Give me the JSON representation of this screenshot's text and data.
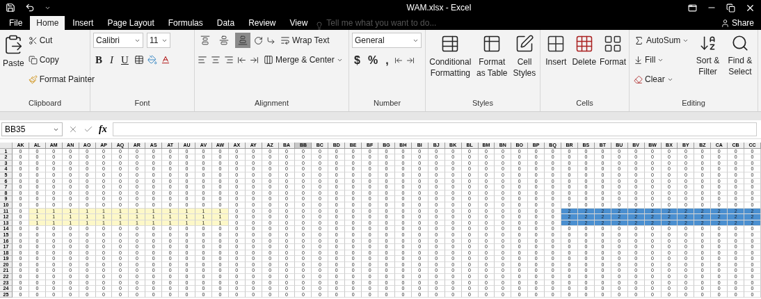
{
  "window": {
    "title": "WAM.xlsx - Excel"
  },
  "tabs": [
    {
      "label": "File",
      "selected": false
    },
    {
      "label": "Home",
      "selected": true
    },
    {
      "label": "Insert",
      "selected": false
    },
    {
      "label": "Page Layout",
      "selected": false
    },
    {
      "label": "Formulas",
      "selected": false
    },
    {
      "label": "Data",
      "selected": false
    },
    {
      "label": "Review",
      "selected": false
    },
    {
      "label": "View",
      "selected": false
    }
  ],
  "tell_me": {
    "placeholder": "Tell me what you want to do..."
  },
  "share": "Share",
  "clipboard": {
    "label": "Clipboard",
    "paste": "Paste",
    "cut": "Cut",
    "copy": "Copy",
    "format_painter": "Format Painter"
  },
  "font": {
    "label": "Font",
    "name": "Calibri",
    "size": "11",
    "bold": "B",
    "italic": "I",
    "underline": "U"
  },
  "alignment": {
    "label": "Alignment",
    "vertical": [
      {
        "selected": false
      },
      {
        "selected": false
      },
      {
        "selected": true
      }
    ],
    "wrap_text": "Wrap Text",
    "merge_center": "Merge & Center"
  },
  "number": {
    "label": "Number",
    "format": "General",
    "currency": "$",
    "percent": "%",
    "comma": ","
  },
  "styles": {
    "label": "Styles",
    "buttons": [
      {
        "kind": "conditional",
        "label": "Conditional Formatting"
      },
      {
        "kind": "table",
        "label": "Format as Table"
      },
      {
        "kind": "cellstyles",
        "label": "Cell Styles"
      }
    ]
  },
  "cells": {
    "label": "Cells",
    "buttons": [
      {
        "kind": "insert",
        "label": "Insert"
      },
      {
        "kind": "delete",
        "label": "Delete"
      },
      {
        "kind": "format",
        "label": "Format"
      }
    ]
  },
  "editing": {
    "label": "Editing",
    "autosum": "AutoSum",
    "fill": "Fill",
    "clear": "Clear",
    "sort": "Sort & Filter",
    "find": "Find & Select"
  },
  "formula_bar": {
    "name_box": "BB35",
    "fx": "fx"
  },
  "columns": [
    {
      "label": "AK",
      "selected": false
    },
    {
      "label": "AL",
      "selected": false
    },
    {
      "label": "AM",
      "selected": false
    },
    {
      "label": "AN",
      "selected": false
    },
    {
      "label": "AO",
      "selected": false
    },
    {
      "label": "AP",
      "selected": false
    },
    {
      "label": "AQ",
      "selected": false
    },
    {
      "label": "AR",
      "selected": false
    },
    {
      "label": "AS",
      "selected": false
    },
    {
      "label": "AT",
      "selected": false
    },
    {
      "label": "AU",
      "selected": false
    },
    {
      "label": "AV",
      "selected": false
    },
    {
      "label": "AW",
      "selected": false
    },
    {
      "label": "AX",
      "selected": false
    },
    {
      "label": "AY",
      "selected": false
    },
    {
      "label": "AZ",
      "selected": false
    },
    {
      "label": "BA",
      "selected": false
    },
    {
      "label": "BB",
      "selected": true
    },
    {
      "label": "BC",
      "selected": false
    },
    {
      "label": "BD",
      "selected": false
    },
    {
      "label": "BE",
      "selected": false
    },
    {
      "label": "BF",
      "selected": false
    },
    {
      "label": "BG",
      "selected": false
    },
    {
      "label": "BH",
      "selected": false
    },
    {
      "label": "BI",
      "selected": false
    },
    {
      "label": "BJ",
      "selected": false
    },
    {
      "label": "BK",
      "selected": false
    },
    {
      "label": "BL",
      "selected": false
    },
    {
      "label": "BM",
      "selected": false
    },
    {
      "label": "BN",
      "selected": false
    },
    {
      "label": "BO",
      "selected": false
    },
    {
      "label": "BP",
      "selected": false
    },
    {
      "label": "BQ",
      "selected": false
    },
    {
      "label": "BR",
      "selected": false
    },
    {
      "label": "BS",
      "selected": false
    },
    {
      "label": "BT",
      "selected": false
    },
    {
      "label": "BU",
      "selected": false
    },
    {
      "label": "BV",
      "selected": false
    },
    {
      "label": "BW",
      "selected": false
    },
    {
      "label": "BX",
      "selected": false
    },
    {
      "label": "BY",
      "selected": false
    },
    {
      "label": "BZ",
      "selected": false
    },
    {
      "label": "CA",
      "selected": false
    },
    {
      "label": "CB",
      "selected": false
    },
    {
      "label": "CC",
      "selected": false
    }
  ],
  "rows": [
    {
      "number": "1",
      "segments": [
        {
          "values": [
            "0",
            "0",
            "0",
            "0",
            "0",
            "0",
            "0",
            "0",
            "0",
            "0",
            "0",
            "0",
            "0",
            "0",
            "0",
            "0",
            "0",
            "0",
            "0",
            "0",
            "0",
            "0",
            "0",
            "0",
            "0",
            "0",
            "0",
            "0",
            "0",
            "0",
            "0",
            "0",
            "0",
            "0",
            "0",
            "0",
            "0",
            "0",
            "0",
            "0",
            "0",
            "0",
            "0",
            "0",
            "0"
          ]
        }
      ]
    },
    {
      "number": "2",
      "segments": [
        {
          "values": [
            "0",
            "0",
            "0",
            "0",
            "0",
            "0",
            "0",
            "0",
            "0",
            "0",
            "0",
            "0",
            "0",
            "0",
            "0",
            "0",
            "0",
            "0",
            "0",
            "0",
            "0",
            "0",
            "0",
            "0",
            "0",
            "0",
            "0",
            "0",
            "0",
            "0",
            "0",
            "0",
            "0",
            "0",
            "0",
            "0",
            "0",
            "0",
            "0",
            "0",
            "0",
            "0",
            "0",
            "0",
            "0"
          ]
        }
      ]
    },
    {
      "number": "3",
      "segments": [
        {
          "values": [
            "0",
            "0",
            "0",
            "0",
            "0",
            "0",
            "0",
            "0",
            "0",
            "0",
            "0",
            "0",
            "0",
            "0",
            "0",
            "0",
            "0",
            "0",
            "0",
            "0",
            "0",
            "0",
            "0",
            "0",
            "0",
            "0",
            "0",
            "0",
            "0",
            "0",
            "0",
            "0",
            "0",
            "0",
            "0",
            "0",
            "0",
            "0",
            "0",
            "0",
            "0",
            "0",
            "0",
            "0",
            "0"
          ]
        }
      ]
    },
    {
      "number": "4",
      "segments": [
        {
          "values": [
            "0",
            "0",
            "0",
            "0",
            "0",
            "0",
            "0",
            "0",
            "0",
            "0",
            "0",
            "0",
            "0",
            "0",
            "0",
            "0",
            "0",
            "0",
            "0",
            "0",
            "0",
            "0",
            "0",
            "0",
            "0",
            "0",
            "0",
            "0",
            "0",
            "0",
            "0",
            "0",
            "0",
            "0",
            "0",
            "0",
            "0",
            "0",
            "0",
            "0",
            "0",
            "0",
            "0",
            "0",
            "0"
          ]
        }
      ]
    },
    {
      "number": "5",
      "segments": [
        {
          "values": [
            "0",
            "0",
            "0",
            "0",
            "0",
            "0",
            "0",
            "0",
            "0",
            "0",
            "0",
            "0",
            "0",
            "0",
            "0",
            "0",
            "0",
            "0",
            "0",
            "0",
            "0",
            "0",
            "0",
            "0",
            "0",
            "0",
            "0",
            "0",
            "0",
            "0",
            "0",
            "0",
            "0",
            "0",
            "0",
            "0",
            "0",
            "0",
            "0",
            "0",
            "0",
            "0",
            "0",
            "0",
            "0"
          ]
        }
      ]
    },
    {
      "number": "6",
      "segments": [
        {
          "values": [
            "0",
            "0",
            "0",
            "0",
            "0",
            "0",
            "0",
            "0",
            "0",
            "0",
            "0",
            "0",
            "0",
            "0",
            "0",
            "0",
            "0",
            "0",
            "0",
            "0",
            "0",
            "0",
            "0",
            "0",
            "0",
            "0",
            "0",
            "0",
            "0",
            "0",
            "0",
            "0",
            "0",
            "0",
            "0",
            "0",
            "0",
            "0",
            "0",
            "0",
            "0",
            "0",
            "0",
            "0",
            "0"
          ]
        }
      ]
    },
    {
      "number": "7",
      "segments": [
        {
          "values": [
            "0",
            "0",
            "0",
            "0",
            "0",
            "0",
            "0",
            "0",
            "0",
            "0",
            "0",
            "0",
            "0",
            "0",
            "0",
            "0",
            "0",
            "0",
            "0",
            "0",
            "0",
            "0",
            "0",
            "0",
            "0",
            "0",
            "0",
            "0",
            "0",
            "0",
            "0",
            "0",
            "0",
            "0",
            "0",
            "0",
            "0",
            "0",
            "0",
            "0",
            "0",
            "0",
            "0",
            "0",
            "0"
          ]
        }
      ]
    },
    {
      "number": "8",
      "segments": [
        {
          "values": [
            "0",
            "0",
            "0",
            "0",
            "0",
            "0",
            "0",
            "0",
            "0",
            "0",
            "0",
            "0",
            "0",
            "0",
            "0",
            "0",
            "0",
            "0",
            "0",
            "0",
            "0",
            "0",
            "0",
            "0",
            "0",
            "0",
            "0",
            "0",
            "0",
            "0",
            "0",
            "0",
            "0",
            "0",
            "0",
            "0",
            "0",
            "0",
            "0",
            "0",
            "0",
            "0",
            "0",
            "0",
            "0"
          ]
        }
      ]
    },
    {
      "number": "9",
      "segments": [
        {
          "values": [
            "0",
            "0",
            "0",
            "0",
            "0",
            "0",
            "0",
            "0",
            "0",
            "0",
            "0",
            "0",
            "0",
            "0",
            "0",
            "0",
            "0",
            "0",
            "0",
            "0",
            "0",
            "0",
            "0",
            "0",
            "0",
            "0",
            "0",
            "0",
            "0",
            "0",
            "0",
            "0",
            "0",
            "0",
            "0",
            "0",
            "0",
            "0",
            "0",
            "0",
            "0",
            "0",
            "0",
            "0",
            "0"
          ]
        }
      ]
    },
    {
      "number": "10",
      "segments": [
        {
          "values": [
            "0",
            "0",
            "0",
            "0",
            "0",
            "0",
            "0",
            "0",
            "0",
            "0",
            "0",
            "0",
            "0",
            "0",
            "0",
            "0",
            "0",
            "0",
            "0",
            "0",
            "0",
            "0",
            "0",
            "0",
            "0",
            "0",
            "0",
            "0",
            "0",
            "0",
            "0",
            "0",
            "0",
            "0",
            "0",
            "0",
            "0",
            "0",
            "0",
            "0",
            "0",
            "0",
            "0",
            "0",
            "0"
          ]
        }
      ]
    },
    {
      "number": "11",
      "segments": [
        {
          "values": [
            "0"
          ]
        },
        {
          "color": "#fdf8c8",
          "values": [
            "1",
            "1",
            "1",
            "1",
            "1",
            "1",
            "1",
            "1",
            "1",
            "1",
            "1",
            "1"
          ]
        },
        {
          "values": [
            "0",
            "0",
            "0",
            "0",
            "0",
            "0",
            "0",
            "0",
            "0",
            "0",
            "0",
            "0",
            "0",
            "0",
            "0",
            "0",
            "0",
            "0",
            "0",
            "0"
          ]
        },
        {
          "color": "#4a8fd0",
          "values": [
            "2",
            "2",
            "2",
            "2",
            "2",
            "2",
            "2",
            "2",
            "2",
            "2",
            "2",
            "2"
          ]
        }
      ]
    },
    {
      "number": "12",
      "segments": [
        {
          "values": [
            "0"
          ]
        },
        {
          "color": "#fdf8c8",
          "values": [
            "1",
            "1",
            "1",
            "1",
            "1",
            "1",
            "1",
            "1",
            "1",
            "1",
            "1",
            "1"
          ]
        },
        {
          "values": [
            "0",
            "0",
            "0",
            "0",
            "0",
            "0",
            "0",
            "0",
            "0",
            "0",
            "0",
            "0",
            "0",
            "0",
            "0",
            "0",
            "0",
            "0",
            "0",
            "0"
          ]
        },
        {
          "color": "#4a8fd0",
          "values": [
            "2",
            "2",
            "2",
            "2",
            "2",
            "2",
            "2",
            "2",
            "2",
            "2",
            "2",
            "2"
          ]
        }
      ]
    },
    {
      "number": "13",
      "segments": [
        {
          "values": [
            "0"
          ]
        },
        {
          "color": "#fdf8c8",
          "values": [
            "1",
            "1",
            "1",
            "1",
            "1",
            "1",
            "1",
            "1",
            "1",
            "1",
            "1",
            "1"
          ]
        },
        {
          "values": [
            "0",
            "0",
            "0",
            "0",
            "0",
            "0",
            "0",
            "0",
            "0",
            "0",
            "0",
            "0",
            "0",
            "0",
            "0",
            "0",
            "0",
            "0",
            "0",
            "0"
          ]
        },
        {
          "color": "#4a8fd0",
          "values": [
            "2",
            "2",
            "2",
            "2",
            "2",
            "2",
            "2",
            "2",
            "2",
            "2",
            "2",
            "2"
          ]
        }
      ]
    },
    {
      "number": "14",
      "segments": [
        {
          "values": [
            "0",
            "0",
            "0",
            "0",
            "0",
            "0",
            "0",
            "0",
            "0",
            "0",
            "0",
            "0",
            "0",
            "0",
            "0",
            "0",
            "0",
            "0",
            "0",
            "0",
            "0",
            "0",
            "0",
            "0",
            "0",
            "0",
            "0",
            "0",
            "0",
            "0",
            "0",
            "0",
            "0",
            "0",
            "0",
            "0",
            "0",
            "0",
            "0",
            "0",
            "0",
            "0",
            "0",
            "0",
            "0"
          ]
        }
      ]
    },
    {
      "number": "15",
      "segments": [
        {
          "values": [
            "0",
            "0",
            "0",
            "0",
            "0",
            "0",
            "0",
            "0",
            "0",
            "0",
            "0",
            "0",
            "0",
            "0",
            "0",
            "0",
            "0",
            "0",
            "0",
            "0",
            "0",
            "0",
            "0",
            "0",
            "0",
            "0",
            "0",
            "0",
            "0",
            "0",
            "0",
            "0",
            "0",
            "0",
            "0",
            "0",
            "0",
            "0",
            "0",
            "0",
            "0",
            "0",
            "0",
            "0",
            "0"
          ]
        }
      ]
    },
    {
      "number": "16",
      "segments": [
        {
          "values": [
            "0",
            "0",
            "0",
            "0",
            "0",
            "0",
            "0",
            "0",
            "0",
            "0",
            "0",
            "0",
            "0",
            "0",
            "0",
            "0",
            "0",
            "0",
            "0",
            "0",
            "0",
            "0",
            "0",
            "0",
            "0",
            "0",
            "0",
            "0",
            "0",
            "0",
            "0",
            "0",
            "0",
            "0",
            "0",
            "0",
            "0",
            "0",
            "0",
            "0",
            "0",
            "0",
            "0",
            "0",
            "0"
          ]
        }
      ]
    },
    {
      "number": "17",
      "segments": [
        {
          "values": [
            "0",
            "0",
            "0",
            "0",
            "0",
            "0",
            "0",
            "0",
            "0",
            "0",
            "0",
            "0",
            "0",
            "0",
            "0",
            "0",
            "0",
            "0",
            "0",
            "0",
            "0",
            "0",
            "0",
            "0",
            "0",
            "0",
            "0",
            "0",
            "0",
            "0",
            "0",
            "0",
            "0",
            "0",
            "0",
            "0",
            "0",
            "0",
            "0",
            "0",
            "0",
            "0",
            "0",
            "0",
            "0"
          ]
        }
      ]
    },
    {
      "number": "18",
      "segments": [
        {
          "values": [
            "0",
            "0",
            "0",
            "0",
            "0",
            "0",
            "0",
            "0",
            "0",
            "0",
            "0",
            "0",
            "0",
            "0",
            "0",
            "0",
            "0",
            "0",
            "0",
            "0",
            "0",
            "0",
            "0",
            "0",
            "0",
            "0",
            "0",
            "0",
            "0",
            "0",
            "0",
            "0",
            "0",
            "0",
            "0",
            "0",
            "0",
            "0",
            "0",
            "0",
            "0",
            "0",
            "0",
            "0",
            "0"
          ]
        }
      ]
    },
    {
      "number": "19",
      "segments": [
        {
          "values": [
            "0",
            "0",
            "0",
            "0",
            "0",
            "0",
            "0",
            "0",
            "0",
            "0",
            "0",
            "0",
            "0",
            "0",
            "0",
            "0",
            "0",
            "0",
            "0",
            "0",
            "0",
            "0",
            "0",
            "0",
            "0",
            "0",
            "0",
            "0",
            "0",
            "0",
            "0",
            "0",
            "0",
            "0",
            "0",
            "0",
            "0",
            "0",
            "0",
            "0",
            "0",
            "0",
            "0",
            "0",
            "0"
          ]
        }
      ]
    },
    {
      "number": "20",
      "segments": [
        {
          "values": [
            "0",
            "0",
            "0",
            "0",
            "0",
            "0",
            "0",
            "0",
            "0",
            "0",
            "0",
            "0",
            "0",
            "0",
            "0",
            "0",
            "0",
            "0",
            "0",
            "0",
            "0",
            "0",
            "0",
            "0",
            "0",
            "0",
            "0",
            "0",
            "0",
            "0",
            "0",
            "0",
            "0",
            "0",
            "0",
            "0",
            "0",
            "0",
            "0",
            "0",
            "0",
            "0",
            "0",
            "0",
            "0"
          ]
        }
      ]
    },
    {
      "number": "21",
      "segments": [
        {
          "values": [
            "0",
            "0",
            "0",
            "0",
            "0",
            "0",
            "0",
            "0",
            "0",
            "0",
            "0",
            "0",
            "0",
            "0",
            "0",
            "0",
            "0",
            "0",
            "0",
            "0",
            "0",
            "0",
            "0",
            "0",
            "0",
            "0",
            "0",
            "0",
            "0",
            "0",
            "0",
            "0",
            "0",
            "0",
            "0",
            "0",
            "0",
            "0",
            "0",
            "0",
            "0",
            "0",
            "0",
            "0",
            "0"
          ]
        }
      ]
    },
    {
      "number": "22",
      "segments": [
        {
          "values": [
            "0",
            "0",
            "0",
            "0",
            "0",
            "0",
            "0",
            "0",
            "0",
            "0",
            "0",
            "0",
            "0",
            "0",
            "0",
            "0",
            "0",
            "0",
            "0",
            "0",
            "0",
            "0",
            "0",
            "0",
            "0",
            "0",
            "0",
            "0",
            "0",
            "0",
            "0",
            "0",
            "0",
            "0",
            "0",
            "0",
            "0",
            "0",
            "0",
            "0",
            "0",
            "0",
            "0",
            "0",
            "0"
          ]
        }
      ]
    },
    {
      "number": "23",
      "segments": [
        {
          "values": [
            "0",
            "0",
            "0",
            "0",
            "0",
            "0",
            "0",
            "0",
            "0",
            "0",
            "0",
            "0",
            "0",
            "0",
            "0",
            "0",
            "0",
            "0",
            "0",
            "0",
            "0",
            "0",
            "0",
            "0",
            "0",
            "0",
            "0",
            "0",
            "0",
            "0",
            "0",
            "0",
            "0",
            "0",
            "0",
            "0",
            "0",
            "0",
            "0",
            "0",
            "0",
            "0",
            "0",
            "0",
            "0"
          ]
        }
      ]
    },
    {
      "number": "24",
      "segments": [
        {
          "values": [
            "0",
            "0",
            "0",
            "0",
            "0",
            "0",
            "0",
            "0",
            "0",
            "0",
            "0",
            "0",
            "0",
            "0",
            "0",
            "0",
            "0",
            "0",
            "0",
            "0",
            "0",
            "0",
            "0",
            "0",
            "0",
            "0",
            "0",
            "0",
            "0",
            "0",
            "0",
            "0",
            "0",
            "0",
            "0",
            "0",
            "0",
            "0",
            "0",
            "0",
            "0",
            "0",
            "0",
            "0",
            "0"
          ]
        }
      ]
    },
    {
      "number": "25",
      "segments": [
        {
          "values": [
            "0",
            "0",
            "0",
            "0",
            "0",
            "0",
            "0",
            "0",
            "0",
            "0",
            "0",
            "0",
            "0",
            "0",
            "0",
            "0",
            "0",
            "0",
            "0",
            "0",
            "0",
            "0",
            "0",
            "0",
            "0",
            "0",
            "0",
            "0",
            "0",
            "0",
            "0",
            "0",
            "0",
            "0",
            "0",
            "0",
            "0",
            "0",
            "0",
            "0",
            "0",
            "0",
            "0",
            "0",
            "0"
          ]
        }
      ]
    }
  ]
}
